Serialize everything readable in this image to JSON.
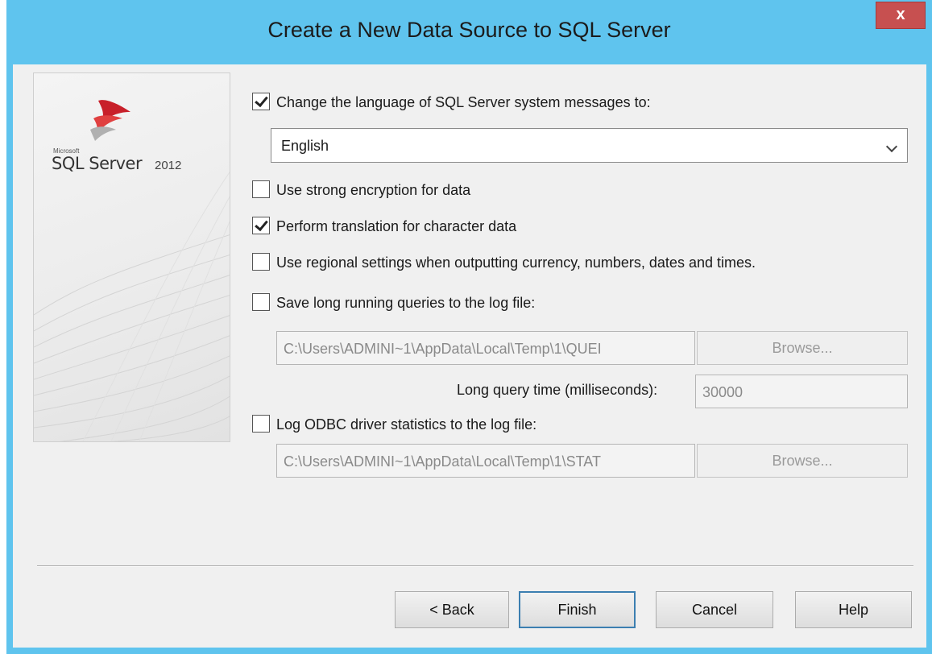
{
  "window": {
    "title": "Create a New Data Source to SQL Server",
    "close_label": "x"
  },
  "banner": {
    "brand_small": "Microsoft",
    "brand_name": "SQL Server",
    "brand_version": "2012",
    "logo_icon": "sql-server-logo-icon"
  },
  "options": {
    "change_language": {
      "label": "Change the language of SQL Server system messages to:",
      "checked": true
    },
    "language_select": {
      "value": "English"
    },
    "strong_encryption": {
      "label": "Use strong encryption for data",
      "checked": false
    },
    "translation": {
      "label": "Perform translation for character data",
      "checked": true
    },
    "regional": {
      "label": "Use regional settings when outputting currency, numbers, dates and times.",
      "checked": false
    },
    "long_queries": {
      "label": "Save long running queries to the log file:",
      "checked": false
    },
    "long_queries_path": "C:\\Users\\ADMINI~1\\AppData\\Local\\Temp\\1\\QUEI",
    "long_queries_browse": "Browse...",
    "long_query_time_label": "Long query time (milliseconds):",
    "long_query_time_value": "30000",
    "odbc_stats": {
      "label": "Log ODBC driver statistics to the log file:",
      "checked": false
    },
    "odbc_stats_path": "C:\\Users\\ADMINI~1\\AppData\\Local\\Temp\\1\\STAT",
    "odbc_stats_browse": "Browse..."
  },
  "buttons": {
    "back": "< Back",
    "finish": "Finish",
    "cancel": "Cancel",
    "help": "Help"
  },
  "colors": {
    "titlebar": "#5fc4ee",
    "close": "#c75050",
    "client": "#f0f0f0",
    "default_button_border": "#3c7fb1"
  }
}
